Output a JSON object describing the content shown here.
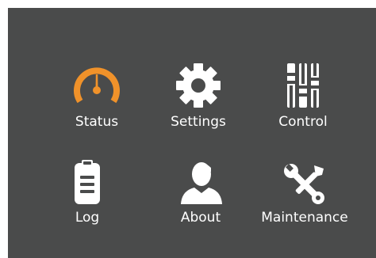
{
  "menu": {
    "items": [
      {
        "label": "Status",
        "icon": "gauge-icon",
        "color": "#f0922a"
      },
      {
        "label": "Settings",
        "icon": "gear-icon",
        "color": "#ffffff"
      },
      {
        "label": "Control",
        "icon": "sliders-icon",
        "color": "#ffffff"
      },
      {
        "label": "Log",
        "icon": "clipboard-icon",
        "color": "#ffffff"
      },
      {
        "label": "About",
        "icon": "person-icon",
        "color": "#ffffff"
      },
      {
        "label": "Maintenance",
        "icon": "tools-icon",
        "color": "#ffffff"
      }
    ]
  },
  "colors": {
    "panel_background": "#4a4b4b",
    "accent": "#f0922a",
    "text": "#ffffff"
  }
}
